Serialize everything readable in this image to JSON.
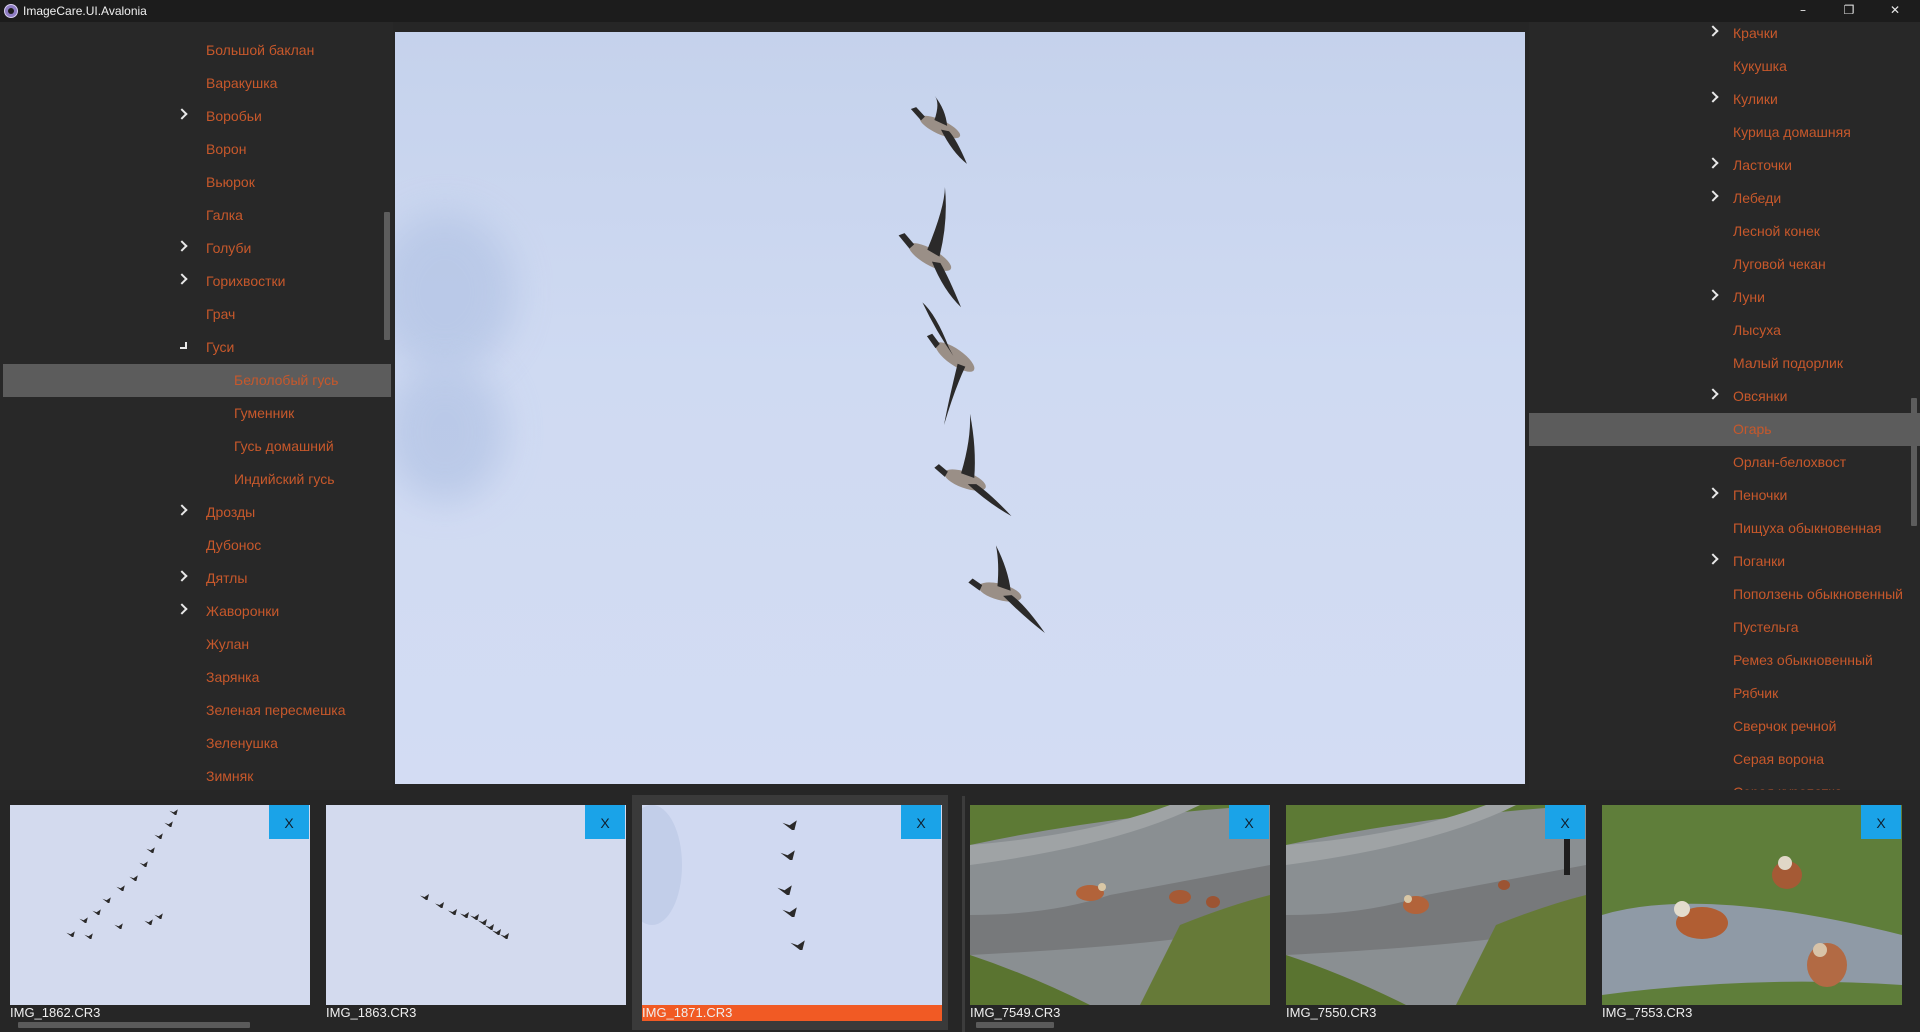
{
  "window": {
    "title": "ImageCare.UI.Avalonia",
    "minimize": "–",
    "restore": "❐",
    "close": "✕"
  },
  "left_tree": [
    {
      "label": "Большой баклан",
      "expander": "none",
      "indent": 0
    },
    {
      "label": "Варакушка",
      "expander": "none",
      "indent": 0
    },
    {
      "label": "Воробьи",
      "expander": "collapsed",
      "indent": 0
    },
    {
      "label": "Ворон",
      "expander": "none",
      "indent": 0
    },
    {
      "label": "Вьюрок",
      "expander": "none",
      "indent": 0
    },
    {
      "label": "Галка",
      "expander": "none",
      "indent": 0
    },
    {
      "label": "Голуби",
      "expander": "collapsed",
      "indent": 0
    },
    {
      "label": "Горихвостки",
      "expander": "collapsed",
      "indent": 0
    },
    {
      "label": "Грач",
      "expander": "none",
      "indent": 0
    },
    {
      "label": "Гуси",
      "expander": "expanded",
      "indent": 0
    },
    {
      "label": "Белолобый гусь",
      "expander": "none",
      "indent": 1,
      "selected": true
    },
    {
      "label": "Гуменник",
      "expander": "none",
      "indent": 1
    },
    {
      "label": "Гусь домашний",
      "expander": "none",
      "indent": 1
    },
    {
      "label": "Индийский гусь",
      "expander": "none",
      "indent": 1
    },
    {
      "label": "Дрозды",
      "expander": "collapsed",
      "indent": 0
    },
    {
      "label": "Дубонос",
      "expander": "none",
      "indent": 0
    },
    {
      "label": "Дятлы",
      "expander": "collapsed",
      "indent": 0
    },
    {
      "label": "Жаворонки",
      "expander": "collapsed",
      "indent": 0
    },
    {
      "label": "Жулан",
      "expander": "none",
      "indent": 0
    },
    {
      "label": "Зарянка",
      "expander": "none",
      "indent": 0
    },
    {
      "label": "Зеленая пересмешка",
      "expander": "none",
      "indent": 0
    },
    {
      "label": "Зеленушка",
      "expander": "none",
      "indent": 0
    },
    {
      "label": "Зимняк",
      "expander": "none",
      "indent": 0
    }
  ],
  "right_tree": [
    {
      "label": "Крачки",
      "expander": "collapsed"
    },
    {
      "label": "Кукушка",
      "expander": "none"
    },
    {
      "label": "Кулики",
      "expander": "collapsed"
    },
    {
      "label": "Курица домашняя",
      "expander": "none"
    },
    {
      "label": "Ласточки",
      "expander": "collapsed"
    },
    {
      "label": "Лебеди",
      "expander": "collapsed"
    },
    {
      "label": "Лесной конек",
      "expander": "none"
    },
    {
      "label": "Луговой чекан",
      "expander": "none"
    },
    {
      "label": "Луни",
      "expander": "collapsed"
    },
    {
      "label": "Лысуха",
      "expander": "none"
    },
    {
      "label": "Малый подорлик",
      "expander": "none"
    },
    {
      "label": "Овсянки",
      "expander": "collapsed"
    },
    {
      "label": "Огарь",
      "expander": "none",
      "selected": true
    },
    {
      "label": "Орлан-белохвост",
      "expander": "none"
    },
    {
      "label": "Пеночки",
      "expander": "collapsed"
    },
    {
      "label": "Пищуха обыкновенная",
      "expander": "none"
    },
    {
      "label": "Поганки",
      "expander": "collapsed"
    },
    {
      "label": "Поползень обыкновенный",
      "expander": "none"
    },
    {
      "label": "Пустельга",
      "expander": "none"
    },
    {
      "label": "Ремез обыкновенный",
      "expander": "none"
    },
    {
      "label": "Рябчик",
      "expander": "none"
    },
    {
      "label": "Сверчок речной",
      "expander": "none"
    },
    {
      "label": "Серая ворона",
      "expander": "none"
    },
    {
      "label": "Серая куропатка",
      "expander": "none"
    }
  ],
  "thumbnails": [
    {
      "filename": "IMG_1862.CR3",
      "remove_label": "X",
      "scene": "sky-flock-v",
      "active": false
    },
    {
      "filename": "IMG_1863.CR3",
      "remove_label": "X",
      "scene": "sky-flock-line",
      "active": false
    },
    {
      "filename": "IMG_1871.CR3",
      "remove_label": "X",
      "scene": "sky-five-geese",
      "active": true
    },
    {
      "filename": "IMG_7549.CR3",
      "remove_label": "X",
      "scene": "path-ducks",
      "active": false
    },
    {
      "filename": "IMG_7550.CR3",
      "remove_label": "X",
      "scene": "path-ducks-2",
      "active": false
    },
    {
      "filename": "IMG_7553.CR3",
      "remove_label": "X",
      "scene": "puddle-ducks",
      "active": false
    }
  ],
  "colors": {
    "tree_text": "#c7582b",
    "selection_bg": "#5c5c5c",
    "active_caption": "#f15a24",
    "remove_button": "#1aa3e8"
  },
  "icons": [
    "app-icon",
    "chevron-right-icon",
    "chevron-expanded-icon",
    "minimize-icon",
    "restore-icon",
    "close-icon"
  ]
}
